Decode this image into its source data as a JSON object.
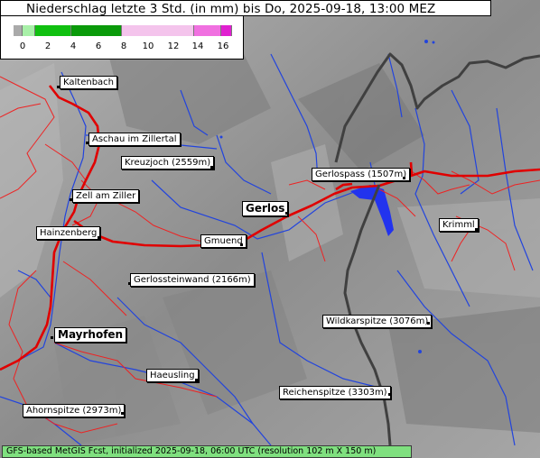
{
  "title": "Niederschlag letzte 3 Std. (in mm) bis Do, 2025-09-18, 13:00 MEZ",
  "legend": {
    "ticks": [
      "0",
      "2",
      "4",
      "6",
      "8",
      "10",
      "12",
      "14",
      "16"
    ],
    "colors": {
      "under_zero": "#aaaaaa",
      "light_green": "#a8f0a8",
      "green": "#10c010",
      "dark_green": "#0a9a0a",
      "pink_light": "#f4c4ec",
      "pink": "#f070e0",
      "magenta": "#e020d0"
    }
  },
  "places": [
    {
      "name": "Kaltenbach",
      "style": "normal"
    },
    {
      "name": "Aschau im Zillertal",
      "style": "normal"
    },
    {
      "name": "Kreuzjoch (2559m)",
      "style": "normal"
    },
    {
      "name": "Zell am Ziller",
      "style": "normal"
    },
    {
      "name": "Gerlospass (1507m)",
      "style": "normal"
    },
    {
      "name": "Gerlos",
      "style": "big"
    },
    {
      "name": "Krimml",
      "style": "normal"
    },
    {
      "name": "Hainzenberg",
      "style": "normal"
    },
    {
      "name": "Gmuend",
      "style": "normal"
    },
    {
      "name": "Gerlossteinwand (2166m)",
      "style": "normal"
    },
    {
      "name": "Wildkarspitze (3076m)",
      "style": "normal"
    },
    {
      "name": "Mayrhofen",
      "style": "big"
    },
    {
      "name": "Haeusling",
      "style": "normal"
    },
    {
      "name": "Reichenspitze (3303m)",
      "style": "normal"
    },
    {
      "name": "Ahornspitze (2973m)",
      "style": "normal"
    }
  ],
  "footer": "GFS-based MetGIS Fcst, initialized 2025-09-18, 06:00 UTC (resolution 102 m X 150 m)",
  "colors": {
    "terrain": "#9a9a9a",
    "rivers": "#2244dd",
    "main_roads": "#e00000",
    "minor_roads": "#ee2222",
    "border": "#404040",
    "footer_bg": "#7fe07f"
  }
}
